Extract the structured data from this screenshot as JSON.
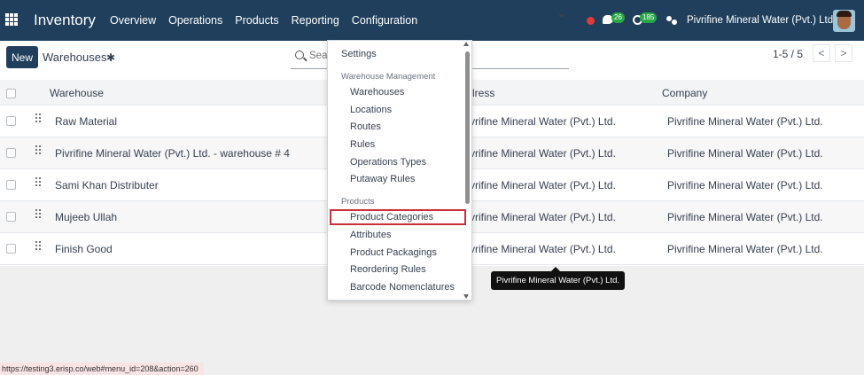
{
  "topbar": {
    "app_title": "Inventory",
    "nav": [
      "Overview",
      "Operations",
      "Products",
      "Reporting",
      "Configuration"
    ],
    "chat_count": "26",
    "activity_count": "185",
    "company_name": "Pivrifine Mineral Water (Pvt.) Ltd."
  },
  "control": {
    "new_label": "New",
    "breadcrumb": "Warehouses",
    "search_placeholder": "Sear",
    "pager": "1-5 / 5",
    "pager_prev": "<",
    "pager_next": ">"
  },
  "table": {
    "headers": {
      "warehouse": "Warehouse",
      "address": "lress",
      "company": "Company"
    },
    "rows": [
      {
        "name": "Raw Material",
        "address": "vrifine Mineral Water (Pvt.) Ltd.",
        "company": "Pivrifine Mineral Water (Pvt.) Ltd."
      },
      {
        "name": "Pivrifine Mineral Water (Pvt.) Ltd. - warehouse # 4",
        "address": "vrifine Mineral Water (Pvt.) Ltd.",
        "company": "Pivrifine Mineral Water (Pvt.) Ltd."
      },
      {
        "name": "Sami Khan Distributer",
        "address": "vrifine Mineral Water (Pvt.) Ltd.",
        "company": "Pivrifine Mineral Water (Pvt.) Ltd."
      },
      {
        "name": "Mujeeb Ullah",
        "address": "vrifine Mineral Water (Pvt.) Ltd.",
        "company": "Pivrifine Mineral Water (Pvt.) Ltd."
      },
      {
        "name": "Finish Good",
        "address": "vrifine Mineral Water (Pvt.) Ltd.",
        "company": "Pivrifine Mineral Water (Pvt.) Ltd."
      }
    ]
  },
  "dropdown": {
    "settings": "Settings",
    "warehouse_mgmt_header": "Warehouse Management",
    "warehouse_items": [
      "Warehouses",
      "Locations",
      "Routes",
      "Rules",
      "Operations Types",
      "Putaway Rules"
    ],
    "products_header": "Products",
    "product_items": [
      "Product Categories",
      "Attributes",
      "Product Packagings",
      "Reordering Rules",
      "Barcode Nomenclatures"
    ]
  },
  "tooltip": "Pivrifine Mineral Water (Pvt.) Ltd.",
  "status_url": "https://testing3.erisp.co/web#menu_id=208&action=260",
  "colors": {
    "topbar": "#1f3f5c",
    "highlight": "#cc2f3a",
    "badge": "#28a745"
  }
}
